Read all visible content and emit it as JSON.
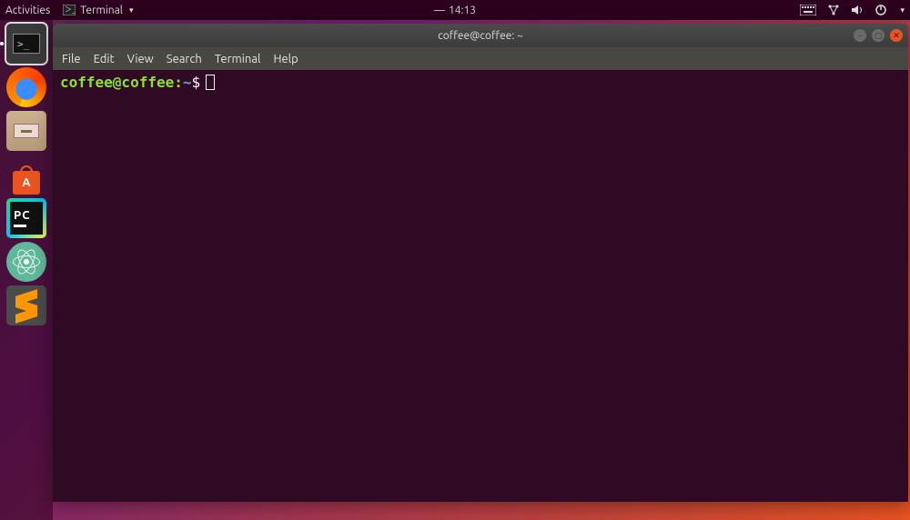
{
  "top_panel": {
    "activities": "Activities",
    "app_label": "Terminal",
    "clock_time": "14:13"
  },
  "launcher": [
    {
      "name": "terminal",
      "active": true
    },
    {
      "name": "firefox",
      "active": false
    },
    {
      "name": "files",
      "active": false
    },
    {
      "name": "software",
      "active": false
    },
    {
      "name": "pycharm",
      "active": false
    },
    {
      "name": "atom",
      "active": false
    },
    {
      "name": "sublime",
      "active": false
    }
  ],
  "window": {
    "title": "coffee@coffee: ~",
    "menu": {
      "file": "File",
      "edit": "Edit",
      "view": "View",
      "search": "Search",
      "terminal": "Terminal",
      "help": "Help"
    },
    "prompt": {
      "userhost": "coffee@coffee",
      "sep": ":",
      "path": "~",
      "dollar": "$"
    }
  },
  "software_letter": "A",
  "pycharm_label": "PC"
}
